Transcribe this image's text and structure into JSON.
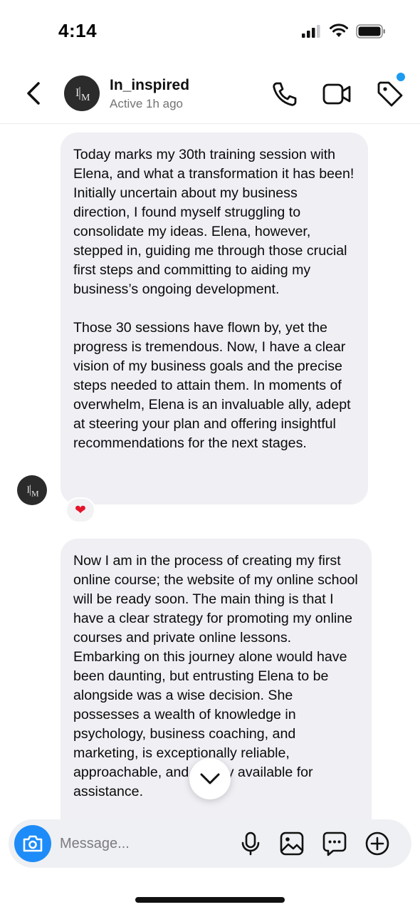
{
  "status_bar": {
    "time": "4:14"
  },
  "header": {
    "username": "In_inspired",
    "active_status": "Active 1h ago",
    "avatar_monogram": "IM"
  },
  "messages": [
    {
      "paragraphs": [
        "Today marks my 30th training session with Elena, and what a transformation it has been! Initially uncertain about my business direction, I found myself struggling to consolidate my ideas. Elena, however, stepped in, guiding me through those crucial first steps and committing to aiding my business’s ongoing development.",
        "Those 30 sessions have flown by, yet the progress is tremendous. Now, I have a clear vision of my business goals and the precise steps needed to attain them. In moments of overwhelm, Elena is an invaluable ally, adept at steering your plan and offering insightful recommendations for the next stages."
      ],
      "reaction": "❤"
    },
    {
      "paragraphs": [
        "Now I am in the process of creating my first online course; the website of my online school will be ready soon. The main thing is that I have a clear strategy for promoting my online courses and private online lessons. Embarking on this journey alone would have been daunting, but entrusting Elena to be alongside was a wise decision. She possesses a wealth of knowledge in psychology, business coaching, and marketing, is exceptionally reliable, approachable, and readily available for assistance."
      ]
    }
  ],
  "composer": {
    "placeholder": "Message..."
  },
  "colors": {
    "accent_blue": "#1d8cf8",
    "bubble_bg": "#efeff4",
    "reaction_heart": "#e5142a"
  },
  "icons": [
    "back-icon",
    "phone-icon",
    "video-camera-icon",
    "tag-icon",
    "camera-icon",
    "microphone-icon",
    "gallery-icon",
    "sticker-icon",
    "plus-icon",
    "chevron-down-icon",
    "heart-icon"
  ]
}
